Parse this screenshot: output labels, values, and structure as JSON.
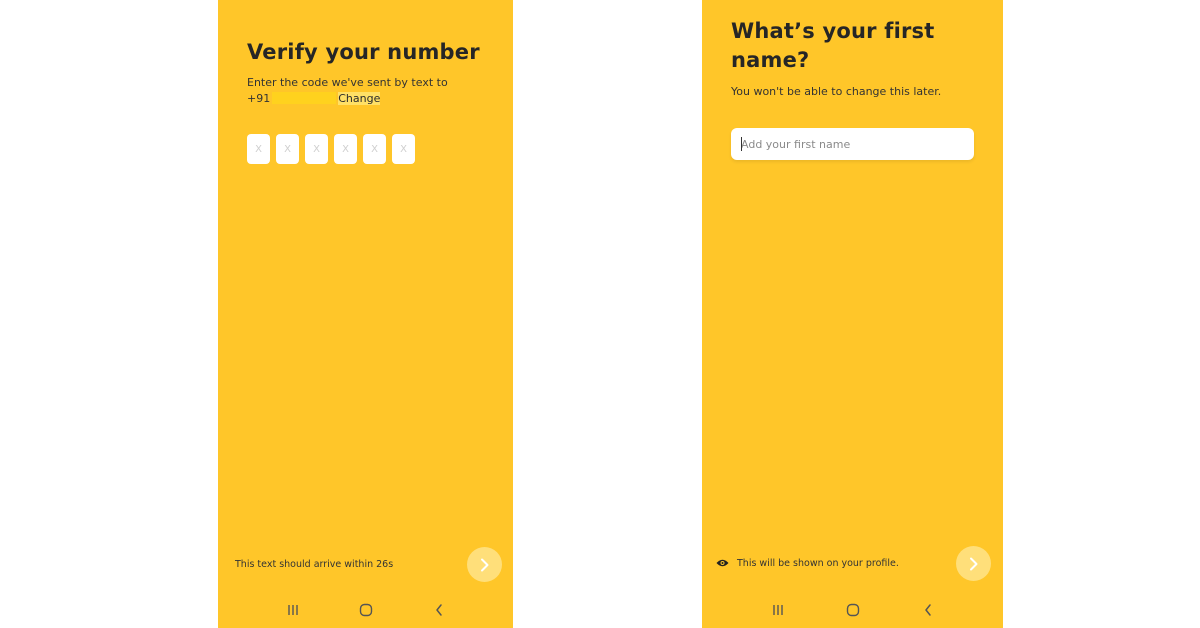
{
  "verify_screen": {
    "title": "Verify your number",
    "instruction": "Enter the code we've sent by text to",
    "country_code": "+91",
    "change_link": "Change",
    "code_placeholders": [
      "X",
      "X",
      "X",
      "X",
      "X",
      "X"
    ],
    "arrival_notice": "This text should arrive within 26s"
  },
  "name_screen": {
    "title_line1": "What’s your first",
    "title_line2": "name?",
    "subtitle": "You won't be able to change this later.",
    "input_placeholder": "Add your first name",
    "visibility_notice": "This will be shown on your profile."
  },
  "icons": {
    "next": "chevron-right-icon",
    "eye": "eye-icon",
    "recents": "recents-icon",
    "home": "home-icon",
    "back": "back-icon"
  },
  "colors": {
    "background": "#ffc629",
    "next_button": "#ffdf7a",
    "input": "#ffffff"
  }
}
